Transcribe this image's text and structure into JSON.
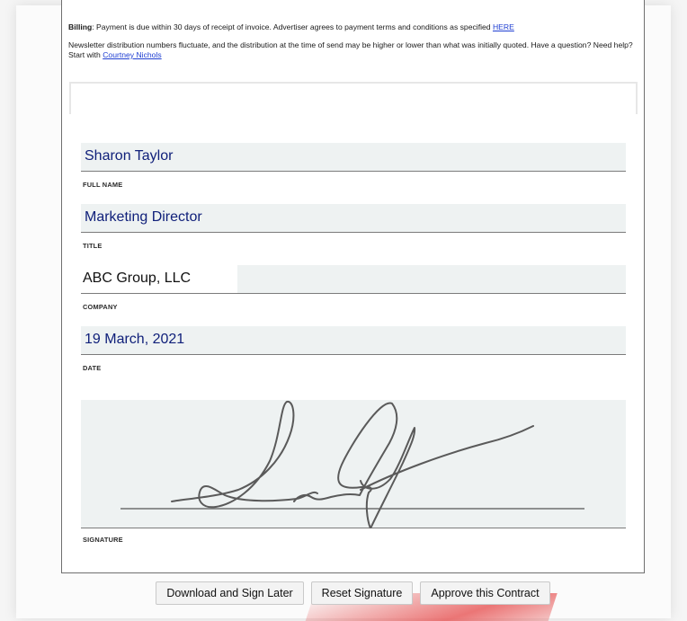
{
  "billing": {
    "heading": "Billing",
    "text": ": Payment is due within 30 days of receipt of invoice. Advertiser agrees to payment terms and conditions as specified ",
    "link": "HERE"
  },
  "note": {
    "text": "Newsletter distribution numbers fluctuate, and the distribution at the time of send may be higher or lower than what was initially quoted. Have a question? Need help? Start with ",
    "link": "Courtney Nichols"
  },
  "fields": {
    "full_name": {
      "value": "Sharon Taylor",
      "label": "FULL NAME"
    },
    "title": {
      "value": "Marketing Director",
      "label": "TITLE"
    },
    "company": {
      "value": "ABC Group, LLC",
      "label": "COMPANY"
    },
    "date": {
      "value": "19 March, 2021",
      "label": "DATE"
    }
  },
  "signature": {
    "label": "SIGNATURE"
  },
  "buttons": {
    "download": "Download and Sign Later",
    "reset": "Reset Signature",
    "approve": "Approve this Contract"
  },
  "colors": {
    "field_bg": "#eef2f2",
    "value_text": "#10207a",
    "link": "#1f3fd2",
    "accent_red": "#e85e5e"
  }
}
